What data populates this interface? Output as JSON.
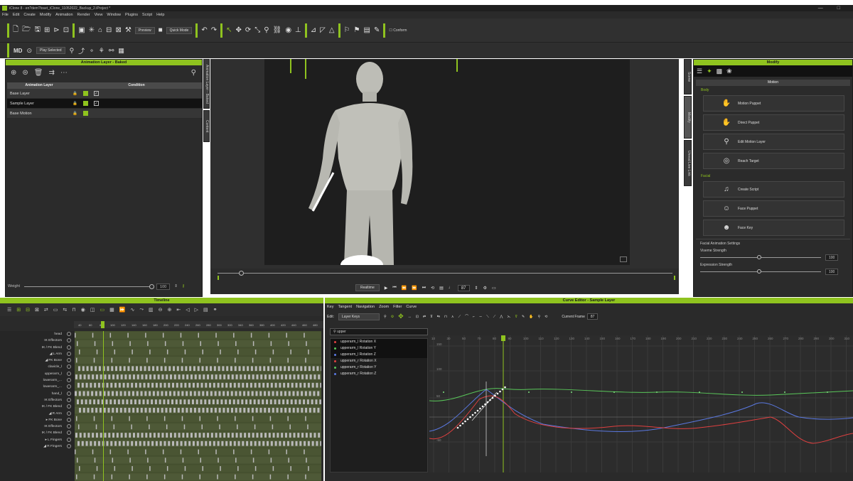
{
  "app": {
    "window_title": "iClone 8 - en?dem?loset_iClone_11052022_Backup_2.iProject *",
    "window_controls": [
      "—",
      "□"
    ]
  },
  "menu": [
    "File",
    "Edit",
    "Create",
    "Modify",
    "Animation",
    "Render",
    "View",
    "Window",
    "Plugins",
    "Script",
    "Help"
  ],
  "toolbar1": {
    "preview_label": "Preview",
    "quick_mode_label": "Quick Mode",
    "conform_label": "Conform"
  },
  "toolbar2": {
    "play_selected_label": "Play Selected"
  },
  "animation_layer": {
    "panel_title": "Animation Layer - Baked",
    "col_layer": "Animation Layer",
    "col_condition": "Condition",
    "layers": [
      {
        "name": "Base Layer",
        "checked": true
      },
      {
        "name": "Sample Layer",
        "checked": true
      },
      {
        "name": "Base Motion",
        "checked": false
      }
    ],
    "weight_label": "Weight",
    "weight_value": "100"
  },
  "side_tabs": {
    "left_1": "Animation Layer - Baked",
    "left_2": "Content",
    "right_1": "Scene",
    "right_2": "Modify",
    "right_3": "Unreal Live Link"
  },
  "playback": {
    "realtime_label": "Realtime",
    "frame_value": "87"
  },
  "modify": {
    "panel_title": "Modify",
    "motion_header": "Motion",
    "body_section": "Body",
    "body_buttons": [
      "Motion Puppet",
      "Direct Puppet",
      "Edit Motion Layer",
      "Reach Target"
    ],
    "facial_section": "Facial",
    "facial_buttons": [
      "Create Script",
      "Face Puppet",
      "Face Key"
    ],
    "facial_settings_label": "Facial Animation Settings",
    "viseme_label": "Viseme Strength",
    "viseme_value": "100",
    "expression_label": "Expression Strength",
    "expression_value": "100"
  },
  "timeline": {
    "panel_title": "Timeline",
    "ruler": [
      "40",
      "60",
      "80",
      "100",
      "120",
      "140",
      "160",
      "180",
      "200",
      "220",
      "240",
      "260",
      "280",
      "300",
      "320",
      "340",
      "360",
      "380",
      "400",
      "420",
      "440",
      "460",
      "480"
    ],
    "tracks": [
      "head",
      "IK Effectors",
      "IK / FK Blend",
      "◢ L Arm",
      "◢ FK Bone",
      "clavicle_l",
      "upperarm_l",
      "lowerarm_...",
      "lowerarm_...",
      "hand_l",
      "IK Effectors",
      "IK / FK Blend",
      "◢ R Arm",
      "▸ FK Bone",
      "IK Effectors",
      "IK / FK Blend",
      "▸ L Fingers",
      "◢ R Fingers"
    ]
  },
  "curve_editor": {
    "panel_title": "Curve Editor - Sample Layer",
    "menu": [
      "Key",
      "Tangent",
      "Navigation",
      "Zoom",
      "Filter",
      "Curve"
    ],
    "edit_label": "Edit:",
    "edit_value": "Layer Keys",
    "current_frame_label": "Current Frame",
    "current_frame_value": "87",
    "search_value": "upper",
    "curves": [
      {
        "name": "upperarm_l Rotation X",
        "color": "#e04040"
      },
      {
        "name": "upperarm_l Rotation Y",
        "color": "#5ac85a"
      },
      {
        "name": "upperarm_l Rotation Z",
        "color": "#5a78e0"
      },
      {
        "name": "upperarm_r Rotation X",
        "color": "#e04040"
      },
      {
        "name": "upperarm_r Rotation Y",
        "color": "#5ac85a"
      },
      {
        "name": "upperarm_r Rotation Z",
        "color": "#5a78e0"
      }
    ],
    "x_ticks": [
      "10",
      "30",
      "50",
      "70",
      "80",
      "90",
      "100",
      "110",
      "120",
      "130",
      "140",
      "150",
      "160",
      "170",
      "180",
      "190",
      "200",
      "210",
      "220",
      "230",
      "240",
      "250",
      "260",
      "270",
      "280",
      "290",
      "300",
      "310"
    ],
    "y_ticks": [
      "150",
      "100",
      "50",
      "-50"
    ]
  },
  "colors": {
    "accent": "#8fc31f",
    "panel_bg": "#2b2b2b",
    "lane_bg": "#45502f"
  }
}
